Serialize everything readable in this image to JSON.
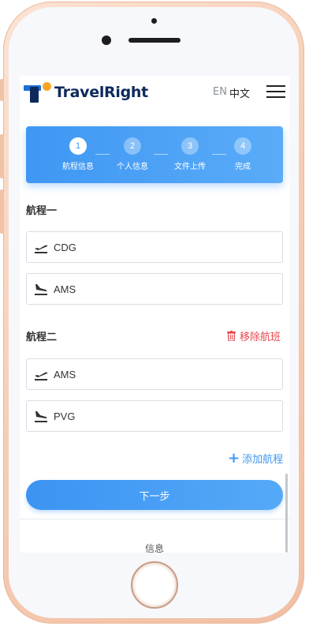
{
  "header": {
    "brand_name": "TravelRight",
    "lang_en": "EN",
    "lang_zh": "中文",
    "menu_icon": "hamburger-menu-icon"
  },
  "stepper": {
    "steps": [
      {
        "number": "1",
        "label": "航程信息",
        "active": true
      },
      {
        "number": "2",
        "label": "个人信息",
        "active": false
      },
      {
        "number": "3",
        "label": "文件上传",
        "active": false
      },
      {
        "number": "4",
        "label": "完成",
        "active": false
      }
    ]
  },
  "itinerary": {
    "leg1": {
      "title": "航程一",
      "departure": {
        "value": "CDG",
        "icon": "plane-takeoff-icon"
      },
      "arrival": {
        "value": "AMS",
        "icon": "plane-landing-icon"
      }
    },
    "leg2": {
      "title": "航程二",
      "remove_label": "移除航班",
      "departure": {
        "value": "AMS",
        "icon": "plane-takeoff-icon"
      },
      "arrival": {
        "value": "PVG",
        "icon": "plane-landing-icon"
      }
    },
    "add_label": "添加航程"
  },
  "next_button": "下一步",
  "footer": {
    "info_label": "信息"
  },
  "colors": {
    "accent": "#3f97f3",
    "danger": "#e5484d",
    "brand_dark": "#0e2a5c",
    "phone_frame": "#f6cdb4"
  }
}
